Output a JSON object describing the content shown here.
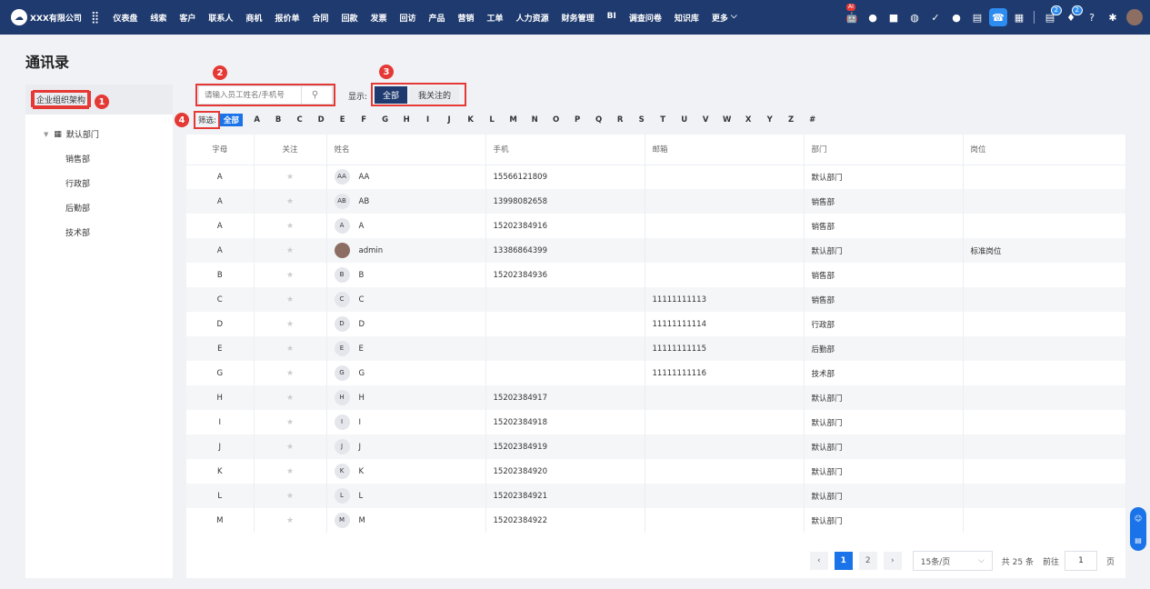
{
  "topbar": {
    "brand": "XXX有限公司",
    "brand_icon": "cloud-logo-icon",
    "nav": [
      "仪表盘",
      "线索",
      "客户",
      "联系人",
      "商机",
      "报价单",
      "合同",
      "回款",
      "发票",
      "回访",
      "产品",
      "营销",
      "工单",
      "人力资源",
      "财务管理",
      "BI",
      "调查问卷",
      "知识库",
      "更多"
    ],
    "tools": [
      {
        "icon": "robot-icon",
        "glyph": "🤖",
        "ai": "AI"
      },
      {
        "icon": "chat-icon",
        "glyph": "●"
      },
      {
        "icon": "message-icon",
        "glyph": "■"
      },
      {
        "icon": "globe-icon",
        "glyph": "◍"
      },
      {
        "icon": "check-square-icon",
        "glyph": "✓"
      },
      {
        "icon": "user-icon",
        "glyph": "●"
      },
      {
        "icon": "document-icon",
        "glyph": "▤"
      },
      {
        "icon": "contacts-icon",
        "glyph": "☎",
        "active": true
      },
      {
        "icon": "calendar-icon",
        "glyph": "▦"
      },
      {
        "icon": "task-icon",
        "glyph": "▤",
        "badge": "2"
      },
      {
        "icon": "bell-icon",
        "glyph": "♦",
        "badge": "2"
      },
      {
        "icon": "help-icon",
        "glyph": "?"
      },
      {
        "icon": "settings-icon",
        "glyph": "✱"
      }
    ]
  },
  "page_title": "通讯录",
  "sidebar": {
    "header": "企业组织架构",
    "root": "默认部门",
    "children": [
      "销售部",
      "行政部",
      "后勤部",
      "技术部"
    ]
  },
  "callouts": [
    "1",
    "2",
    "3",
    "4"
  ],
  "search": {
    "placeholder": "请输入员工姓名/手机号",
    "value": ""
  },
  "display": {
    "label": "显示:",
    "options": [
      "全部",
      "我关注的"
    ],
    "selected": "全部"
  },
  "filter": {
    "label": "筛选:",
    "all": "全部",
    "letters": [
      "A",
      "B",
      "C",
      "D",
      "E",
      "F",
      "G",
      "H",
      "I",
      "J",
      "K",
      "L",
      "M",
      "N",
      "O",
      "P",
      "Q",
      "R",
      "S",
      "T",
      "U",
      "V",
      "W",
      "X",
      "Y",
      "Z",
      "#"
    ]
  },
  "table": {
    "columns": [
      "字母",
      "关注",
      "姓名",
      "手机",
      "邮箱",
      "部门",
      "岗位"
    ],
    "rows": [
      {
        "letter": "A",
        "avatar": "AA",
        "name": "AA",
        "phone": "15566121809",
        "email": "",
        "dept": "默认部门",
        "post": ""
      },
      {
        "letter": "A",
        "avatar": "AB",
        "name": "AB",
        "phone": "13998082658",
        "email": "",
        "dept": "销售部",
        "post": ""
      },
      {
        "letter": "A",
        "avatar": "A",
        "name": "A",
        "phone": "15202384916",
        "email": "",
        "dept": "销售部",
        "post": ""
      },
      {
        "letter": "A",
        "avatar": "",
        "name": "admin",
        "phone": "13386864399",
        "email": "",
        "dept": "默认部门",
        "post": "标准岗位"
      },
      {
        "letter": "B",
        "avatar": "B",
        "name": "B",
        "phone": "15202384936",
        "email": "",
        "dept": "销售部",
        "post": ""
      },
      {
        "letter": "C",
        "avatar": "C",
        "name": "C",
        "phone": "",
        "email": "11111111113",
        "dept": "销售部",
        "post": ""
      },
      {
        "letter": "D",
        "avatar": "D",
        "name": "D",
        "phone": "",
        "email": "11111111114",
        "dept": "行政部",
        "post": ""
      },
      {
        "letter": "E",
        "avatar": "E",
        "name": "E",
        "phone": "",
        "email": "11111111115",
        "dept": "后勤部",
        "post": ""
      },
      {
        "letter": "G",
        "avatar": "G",
        "name": "G",
        "phone": "",
        "email": "11111111116",
        "dept": "技术部",
        "post": ""
      },
      {
        "letter": "H",
        "avatar": "H",
        "name": "H",
        "phone": "15202384917",
        "email": "",
        "dept": "默认部门",
        "post": ""
      },
      {
        "letter": "I",
        "avatar": "I",
        "name": "I",
        "phone": "15202384918",
        "email": "",
        "dept": "默认部门",
        "post": ""
      },
      {
        "letter": "J",
        "avatar": "J",
        "name": "J",
        "phone": "15202384919",
        "email": "",
        "dept": "默认部门",
        "post": ""
      },
      {
        "letter": "K",
        "avatar": "K",
        "name": "K",
        "phone": "15202384920",
        "email": "",
        "dept": "默认部门",
        "post": ""
      },
      {
        "letter": "L",
        "avatar": "L",
        "name": "L",
        "phone": "15202384921",
        "email": "",
        "dept": "默认部门",
        "post": ""
      },
      {
        "letter": "M",
        "avatar": "M",
        "name": "M",
        "phone": "15202384922",
        "email": "",
        "dept": "默认部门",
        "post": ""
      }
    ]
  },
  "pagination": {
    "prev": "‹",
    "next": "›",
    "pages": [
      "1",
      "2"
    ],
    "current": "1",
    "page_size": "15条/页",
    "total": "共 25 条",
    "goto_label": "前往",
    "goto_value": "1",
    "page_suffix": "页"
  },
  "colors": {
    "topbar": "#1e3a6e",
    "accent": "#1a73e8",
    "callout": "#e53935"
  }
}
